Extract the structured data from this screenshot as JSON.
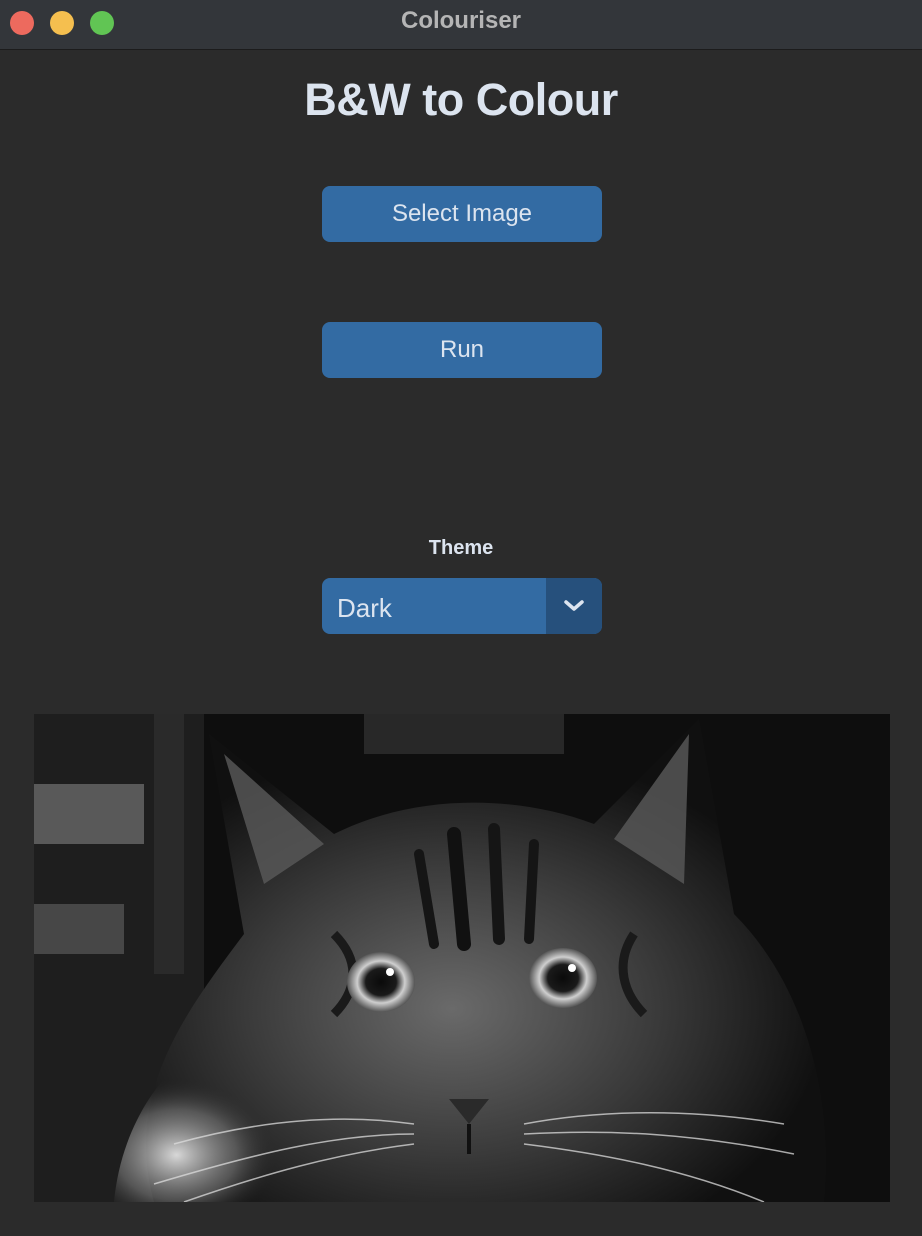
{
  "window": {
    "title": "Colouriser"
  },
  "app": {
    "heading": "B&W to Colour",
    "select_image_label": "Select Image",
    "run_label": "Run"
  },
  "theme": {
    "label": "Theme",
    "selected": "Dark"
  },
  "colors": {
    "background": "#2b2b2b",
    "button": "#336ba3",
    "button_dark": "#26507c",
    "text": "#dce4ef"
  },
  "icons": {
    "dropdown": "chevron-down-icon",
    "window_controls": [
      "close-icon",
      "minimize-icon",
      "zoom-icon"
    ]
  }
}
